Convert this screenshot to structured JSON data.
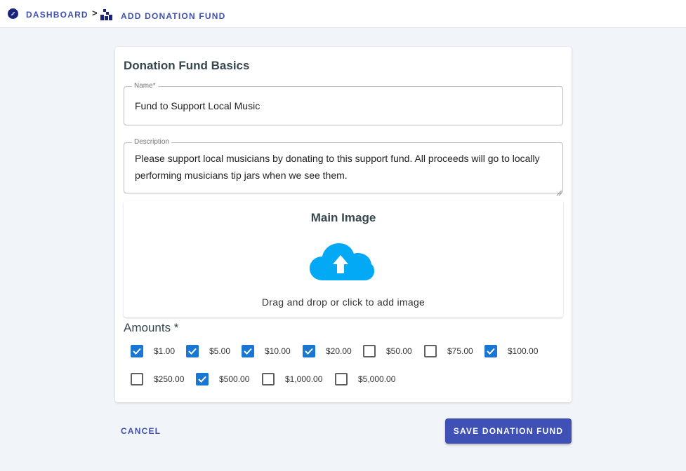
{
  "breadcrumb": {
    "dashboard_label": "DASHBOARD",
    "separator": ">",
    "current_label": "ADD DONATION FUND",
    "dashboard_icon": "compass-icon",
    "current_icon": "donation-blocks-icon"
  },
  "form": {
    "title": "Donation Fund Basics",
    "name_label": "Name*",
    "name_value": "Fund to Support Local Music",
    "description_label": "Description",
    "description_value": "Please support local musicians by donating to this support fund. All proceeds will go to locally performing musicians tip jars when we see them."
  },
  "image_upload": {
    "title": "Main Image",
    "hint": "Drag and drop or click to add image",
    "icon": "cloud-upload-icon",
    "icon_color": "#03a9f4"
  },
  "amounts": {
    "title": "Amounts *",
    "options": [
      {
        "label": "$1.00",
        "checked": true
      },
      {
        "label": "$5.00",
        "checked": true
      },
      {
        "label": "$10.00",
        "checked": true
      },
      {
        "label": "$20.00",
        "checked": true
      },
      {
        "label": "$50.00",
        "checked": false
      },
      {
        "label": "$75.00",
        "checked": false
      },
      {
        "label": "$100.00",
        "checked": true
      },
      {
        "label": "$250.00",
        "checked": false
      },
      {
        "label": "$500.00",
        "checked": true
      },
      {
        "label": "$1,000.00",
        "checked": false
      },
      {
        "label": "$5,000.00",
        "checked": false
      }
    ]
  },
  "actions": {
    "cancel_label": "CANCEL",
    "save_label": "SAVE DONATION FUND"
  },
  "colors": {
    "primary": "#3f51b5",
    "checkbox_checked": "#1976d2",
    "background": "#f1f4f8"
  }
}
